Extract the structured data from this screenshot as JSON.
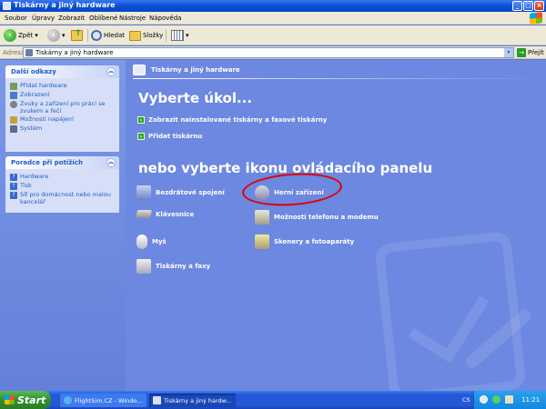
{
  "window": {
    "title": "Tiskárny a jiný hardware"
  },
  "menu": [
    "Soubor",
    "Úpravy",
    "Zobrazit",
    "Oblíbené",
    "Nástroje",
    "Nápověda"
  ],
  "toolbar": {
    "back": "Zpět",
    "search": "Hledat",
    "folders": "Složky"
  },
  "address": {
    "label": "Adresa",
    "value": "Tiskárny a jiný hardware",
    "go": "Přejít"
  },
  "sidebar": {
    "links": {
      "title": "Další odkazy",
      "items": [
        "Přidat hardware",
        "Zobrazení",
        "Zvuky a zařízení pro práci se zvukem a řečí",
        "Možnosti napájení",
        "Systém"
      ]
    },
    "help": {
      "title": "Poradce při potížích",
      "items": [
        "Hardware",
        "Tisk",
        "Síť pro domácnost nebo malou kancelář"
      ]
    }
  },
  "main": {
    "category": "Tiskárny a jiný hardware",
    "pick_task": "Vyberte úkol...",
    "tasks": [
      "Zobrazit nainstalované tiskárny a faxové tiskárny",
      "Přidat tiskárnu"
    ],
    "pick_icon": "nebo vyberte ikonu ovládacího panelu",
    "icons": [
      "Bezdrátové spojení",
      "Herní zařízení",
      "Klávesnice",
      "Možnosti telefonu a modemu",
      "Myš",
      "Skenery a fotoaparáty",
      "Tiskárny a faxy"
    ]
  },
  "taskbar": {
    "start": "Start",
    "tasks": [
      "FlightSim.CZ - Windo...",
      "Tiskárny a jiný hardw..."
    ],
    "lang": "CS",
    "clock": "11:21"
  },
  "colors": {
    "accent": "#215dc6",
    "annotation": "#e00000",
    "task_arrow": "#2aa82a"
  }
}
